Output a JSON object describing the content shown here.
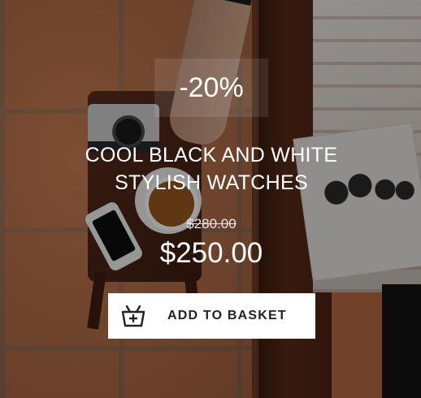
{
  "product": {
    "discount": "-20%",
    "title_line1": "COOL BLACK AND WHITE",
    "title_line2": "STYLISH WATCHES",
    "old_price": "$280.00",
    "price": "$250.00"
  },
  "cta": {
    "label": "ADD TO BASKET",
    "icon": "basket-add-icon"
  },
  "colors": {
    "button_bg": "#ffffff",
    "button_text": "#222222",
    "text": "#ffffff"
  }
}
